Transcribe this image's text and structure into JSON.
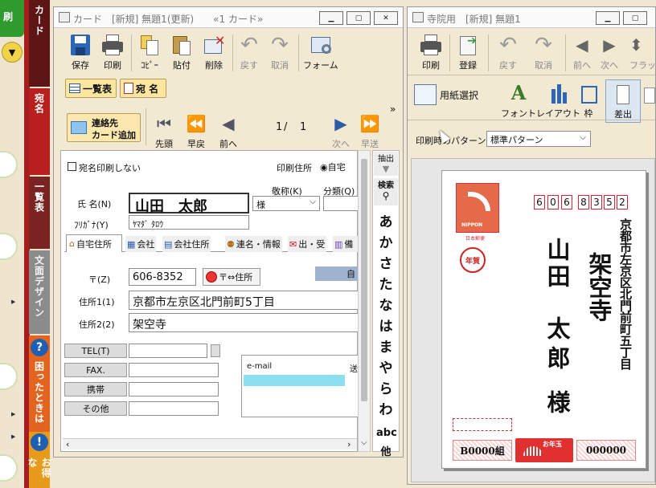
{
  "left_nav": {
    "top_label": "刷",
    "tabs": [
      "カード",
      "宛名",
      "一覧表",
      "文面デザイン",
      "困ったときは",
      "お得な"
    ]
  },
  "card_window": {
    "title": "カード　[新規] 無題1(更新)　　«1 カード»",
    "toolbar": [
      "保存",
      "印刷",
      "ｺﾋﾟｰ",
      "貼付",
      "削除",
      "戻す",
      "取消",
      "フォーム"
    ],
    "view_tabs": [
      "一覧表",
      "宛 名"
    ],
    "add_contact_line1": "連絡先",
    "add_contact_line2": "カード追加",
    "nav": [
      "先頭",
      "早戻",
      "前へ",
      "次へ",
      "早送"
    ],
    "record_current": "1",
    "record_sep": "/",
    "record_total": "1",
    "chevron": "»"
  },
  "form": {
    "no_print_label": "宛名印刷しない",
    "print_addr_label": "印刷住所",
    "print_addr_value": "◉自宅",
    "honorific_label": "敬称(K)",
    "category_label": "分類(Q)",
    "name_label": "氏 名(N)",
    "name_value": "山田　太郎",
    "honorific_value": "様",
    "furigana_label": "ﾌﾘｶﾞﾅ(Y)",
    "furigana_value": "ﾔﾏﾀﾞ ﾀﾛｳ",
    "tabs": [
      "自宅住所",
      "会社",
      "会社住所",
      "連名・情報",
      "出・受",
      "備"
    ],
    "postal_label": "〒(Z)",
    "postal_value": "606-8352",
    "postal_convert": "〒⇔住所",
    "auto_btn": "自",
    "addr1_label": "住所1(1)",
    "addr1_value": "京都市左京区北門前町5丁目",
    "addr2_label": "住所2(2)",
    "addr2_value": "架空寺",
    "tel_label": "TEL(T)",
    "fax_label": "FAX.",
    "mobile_label": "携帯",
    "other_label": "その他",
    "email_label": "e-mail",
    "email_col2": "送"
  },
  "side_index": {
    "extract": "抽出",
    "search": "検索",
    "kana": [
      "あ",
      "か",
      "さ",
      "た",
      "な",
      "は",
      "ま",
      "や",
      "ら",
      "わ"
    ],
    "abc": "abc",
    "more": "他"
  },
  "print_window": {
    "title": "寺院用　[新規] 無題1",
    "toolbar": [
      "印刷",
      "登録",
      "戻す",
      "取消",
      "前へ",
      "次へ",
      "フラッ"
    ],
    "toolbar2": [
      "用紙選択",
      "フォント",
      "レイアウト",
      "枠",
      "差出"
    ],
    "pattern_label": "印刷時のパターン",
    "pattern_value": "標準パターン"
  },
  "postcard": {
    "zip_digits": [
      "6",
      "0",
      "6",
      "8",
      "3",
      "5",
      "2"
    ],
    "address": "京都市左京区北門前町五丁目",
    "temple": "架空寺",
    "surname": "山田",
    "given": "太郎",
    "honorific": "様",
    "nenga": "年賀",
    "otoshidama": "お年玉",
    "lot_left": "B0000組",
    "lot_right": "000000",
    "stamp_text": "NIPPON",
    "stamp_sub": "日本郵便"
  }
}
